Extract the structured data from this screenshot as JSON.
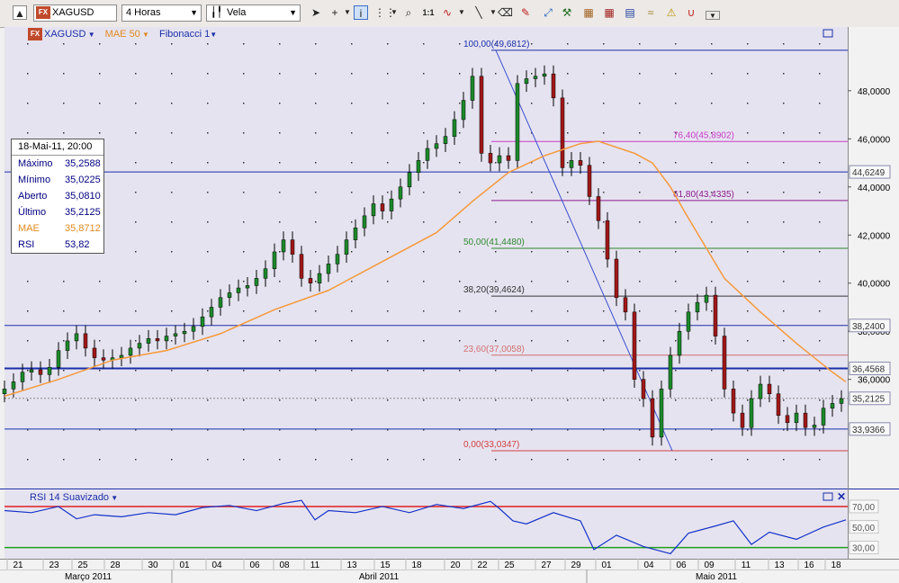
{
  "toolbar": {
    "symbol": "XAGUSD",
    "timeframe": "4 Horas",
    "chart_type": "Vela"
  },
  "legend": {
    "symbol": "XAGUSD",
    "mae": "MAE 50",
    "fib": "Fibonacci 1"
  },
  "info": {
    "date": "18-Mai-11, 20:00",
    "rows": [
      {
        "label": "Máximo",
        "value": "35,2588",
        "color": "#000080"
      },
      {
        "label": "Mínimo",
        "value": "35,0225",
        "color": "#000080"
      },
      {
        "label": "Aberto",
        "value": "35,0810",
        "color": "#000080"
      },
      {
        "label": "Último",
        "value": "35,2125",
        "color": "#000080"
      },
      {
        "label": "MAE",
        "value": "35,8712",
        "color": "#e08a1e"
      },
      {
        "label": "RSI",
        "value": "53,82",
        "color": "#000080"
      }
    ]
  },
  "colors": {
    "panel_bg": "#e6e3f0",
    "price_line": "#1a2fa8",
    "mae": "#f59a3c",
    "rsi": "#1433c8",
    "up": "#1c8a2a",
    "down": "#a01818"
  },
  "chart_data": [
    {
      "type": "line",
      "title": "XAGUSD",
      "timeframe": "4 Horas",
      "ylim": [
        31.5,
        50.5
      ],
      "yticks": [
        {
          "value": 48,
          "label": "48,0000"
        },
        {
          "value": 46,
          "label": "46,0000"
        },
        {
          "value": 44,
          "label": "44,0000"
        },
        {
          "value": 42,
          "label": "42,0000"
        },
        {
          "value": 40,
          "label": "40,0000"
        },
        {
          "value": 38,
          "label": "38,0000"
        },
        {
          "value": 36,
          "label": "36,0000"
        }
      ],
      "price_badges": [
        {
          "value": 44.6249,
          "label": "44,6249"
        },
        {
          "value": 38.24,
          "label": "38,2400"
        },
        {
          "value": 36.4568,
          "label": "36,4568"
        },
        {
          "value": 35.2125,
          "label": "35,2125"
        },
        {
          "value": 33.9366,
          "label": "33,9366"
        }
      ],
      "horizontal_lines": [
        44.6249,
        38.24,
        36.4568,
        33.9366
      ],
      "fibonacci": [
        {
          "label": "100,00(49,6812)",
          "value": 49.6812,
          "color": "#1a2fa8"
        },
        {
          "label": "76,40(45,8902)",
          "value": 45.8902,
          "color": "#c83cc8"
        },
        {
          "label": "61,80(43,4335)",
          "value": 43.4335,
          "color": "#8a1a8a"
        },
        {
          "label": "50,00(41,4480)",
          "value": 41.448,
          "color": "#2e8a2e"
        },
        {
          "label": "38,20(39,4624)",
          "value": 39.4624,
          "color": "#333333"
        },
        {
          "label": "23,60(37,0058)",
          "value": 37.0058,
          "color": "#d07070"
        },
        {
          "label": "0,00(33,0347)",
          "value": 33.0347,
          "color": "#d04040"
        }
      ],
      "series": [
        {
          "name": "XAGUSD",
          "x": [
            0,
            10,
            20,
            30,
            40,
            50,
            60,
            70,
            80,
            90,
            100,
            110,
            120,
            130,
            140,
            150,
            160,
            170,
            180,
            190,
            200,
            210,
            220,
            230,
            240,
            250,
            260,
            270,
            280,
            290,
            300,
            310,
            320,
            330,
            340,
            350,
            360,
            370,
            380,
            390,
            400,
            410,
            420,
            430,
            440,
            450,
            460,
            470,
            480,
            490,
            500,
            510,
            520,
            530,
            540,
            550,
            560,
            570,
            580,
            590,
            600,
            610,
            620,
            630,
            640,
            650,
            660,
            670,
            680,
            690,
            700,
            710,
            720,
            730,
            740,
            750,
            760,
            770,
            780,
            790,
            800,
            810,
            820,
            830,
            840,
            850,
            860,
            870,
            880,
            890,
            900,
            910,
            920,
            930
          ],
          "values": [
            35.6,
            35.9,
            36.3,
            36.4,
            36.2,
            36.5,
            37.2,
            37.6,
            37.9,
            37.3,
            36.9,
            36.8,
            36.9,
            37.0,
            37.3,
            37.5,
            37.7,
            37.6,
            37.8,
            37.9,
            38.0,
            38.2,
            38.6,
            39.0,
            39.4,
            39.6,
            39.8,
            39.9,
            40.2,
            40.6,
            41.3,
            41.8,
            41.2,
            40.2,
            40.0,
            40.4,
            40.8,
            41.2,
            41.8,
            42.3,
            42.8,
            43.3,
            43.0,
            43.5,
            44.0,
            44.6,
            45.1,
            45.6,
            45.8,
            46.1,
            46.8,
            47.6,
            48.6,
            45.4,
            45.0,
            45.3,
            45.1,
            48.3,
            48.5,
            48.6,
            48.7,
            47.7,
            44.8,
            45.1,
            44.9,
            43.6,
            42.6,
            41.0,
            39.4,
            38.8,
            36.0,
            35.2,
            33.6,
            35.6,
            37.0,
            38.0,
            38.8,
            39.2,
            39.5,
            37.8,
            35.6,
            34.6,
            34.0,
            35.2,
            35.8,
            35.4,
            34.5,
            34.2,
            34.6,
            34.0,
            34.1,
            34.8,
            35.0,
            35.2
          ]
        },
        {
          "name": "MAE 50",
          "x": [
            0,
            60,
            120,
            180,
            240,
            300,
            360,
            420,
            480,
            520,
            560,
            600,
            640,
            660,
            700,
            720,
            740,
            760,
            800,
            840,
            880,
            920,
            935
          ],
          "values": [
            35.3,
            36.0,
            36.8,
            37.2,
            37.9,
            38.9,
            39.7,
            40.9,
            42.1,
            43.4,
            44.6,
            45.3,
            45.8,
            45.9,
            45.4,
            45.0,
            44.0,
            42.7,
            40.2,
            38.8,
            37.5,
            36.3,
            35.9
          ]
        }
      ],
      "trendline": {
        "from": {
          "x": 546,
          "value": 49.6812
        },
        "to": {
          "x": 742,
          "value": 33.0347
        }
      }
    },
    {
      "type": "line",
      "title": "RSI 14 Suavizado",
      "ylim": [
        20,
        84
      ],
      "levels": [
        {
          "value": 70,
          "label": "70,00",
          "color": "#e02020"
        },
        {
          "value": 50,
          "label": "50,00",
          "color": "#888888"
        },
        {
          "value": 30,
          "label": "30,00",
          "color": "#20a020"
        }
      ],
      "series": [
        {
          "name": "RSI 14 Suavizado",
          "x": [
            0,
            30,
            60,
            80,
            100,
            130,
            160,
            190,
            220,
            250,
            280,
            310,
            330,
            345,
            360,
            390,
            420,
            450,
            480,
            510,
            540,
            550,
            565,
            580,
            610,
            640,
            655,
            680,
            710,
            740,
            760,
            790,
            810,
            830,
            850,
            880,
            910,
            935
          ],
          "values": [
            66,
            64,
            70,
            58,
            62,
            60,
            64,
            62,
            69,
            71,
            66,
            73,
            76,
            57,
            66,
            64,
            70,
            64,
            72,
            68,
            75,
            68,
            56,
            53,
            64,
            56,
            28,
            42,
            31,
            24,
            44,
            51,
            56,
            33,
            45,
            38,
            50,
            57
          ]
        }
      ]
    }
  ],
  "x_axis": {
    "day_labels": [
      "21",
      "23",
      "25",
      "28",
      "30",
      "01",
      "04",
      "06",
      "08",
      "11",
      "13",
      "15",
      "18",
      "20",
      "22",
      "25",
      "27",
      "29",
      "01",
      "04",
      "06",
      "09",
      "11",
      "13",
      "16",
      "18"
    ],
    "month_labels": [
      "Março 2011",
      "Abril 2011",
      "Maio 2011"
    ]
  }
}
